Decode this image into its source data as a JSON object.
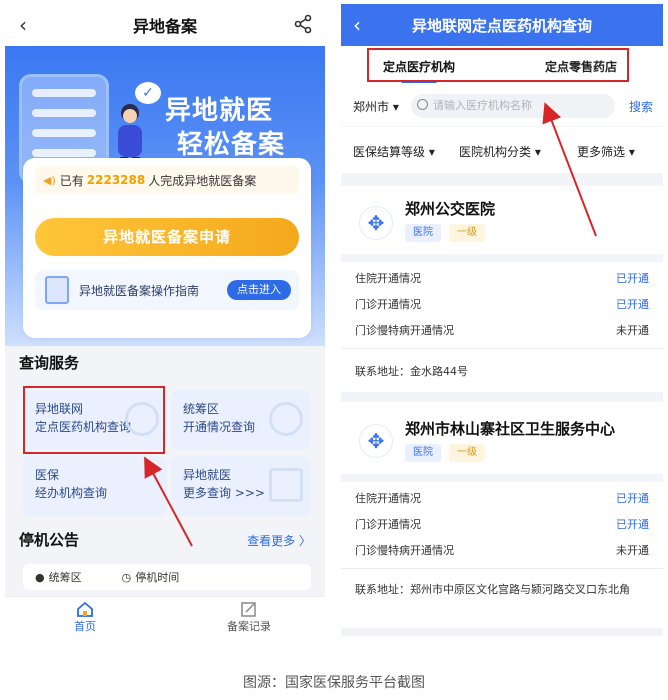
{
  "left": {
    "nav_title": "异地备案",
    "hero_line1": "异地就医",
    "hero_line2": "轻松备案",
    "notice_prefix": "已有",
    "notice_count": "2223288",
    "notice_suffix": "人完成异地就医备案",
    "apply_button": "异地就医备案申请",
    "guide_label": "异地就医备案操作指南",
    "guide_button": "点击进入",
    "query_section_title": "查询服务",
    "services": [
      {
        "line1": "异地联网",
        "line2": "定点医药机构查询"
      },
      {
        "line1": "统筹区",
        "line2": "开通情况查询"
      },
      {
        "line1": "医保",
        "line2": "经办机构查询"
      },
      {
        "line1": "异地就医",
        "line2": "更多查询 >>>"
      }
    ],
    "stop_title": "停机公告",
    "more_link": "查看更多 〉",
    "stop_col1": "统筹区",
    "stop_col2": "停机时间",
    "tab_home": "首页",
    "tab_records": "备案记录"
  },
  "right": {
    "nav_title": "异地联网定点医药机构查询",
    "tab_active": "定点医疗机构",
    "tab_other": "定点零售药店",
    "city": "郑州市 ▾",
    "search_placeholder": "请输入医疗机构名称",
    "search_button": "搜索",
    "filters": [
      "医保结算等级 ▾",
      "医院机构分类 ▾",
      "更多筛选 ▾"
    ],
    "hospitals": [
      {
        "name": "郑州公交医院",
        "type": "医院",
        "level": "一级",
        "rows": [
          {
            "label": "住院开通情况",
            "value": "已开通"
          },
          {
            "label": "门诊开通情况",
            "value": "已开通"
          },
          {
            "label": "门诊慢特病开通情况",
            "value": "未开通"
          }
        ],
        "address": "联系地址：金水路44号"
      },
      {
        "name": "郑州市林山寨社区卫生服务中心",
        "type": "医院",
        "level": "一级",
        "rows": [
          {
            "label": "住院开通情况",
            "value": "已开通"
          },
          {
            "label": "门诊开通情况",
            "value": "已开通"
          },
          {
            "label": "门诊慢特病开通情况",
            "value": "未开通"
          }
        ],
        "address": "联系地址：郑州市中原区文化宫路与颍河路交叉口东北角"
      }
    ]
  },
  "caption": "图源：国家医保服务平台截图",
  "colors": {
    "accent": "#3b73ee",
    "highlight_box": "#d6262a",
    "button_orange": "#f5a81b"
  }
}
